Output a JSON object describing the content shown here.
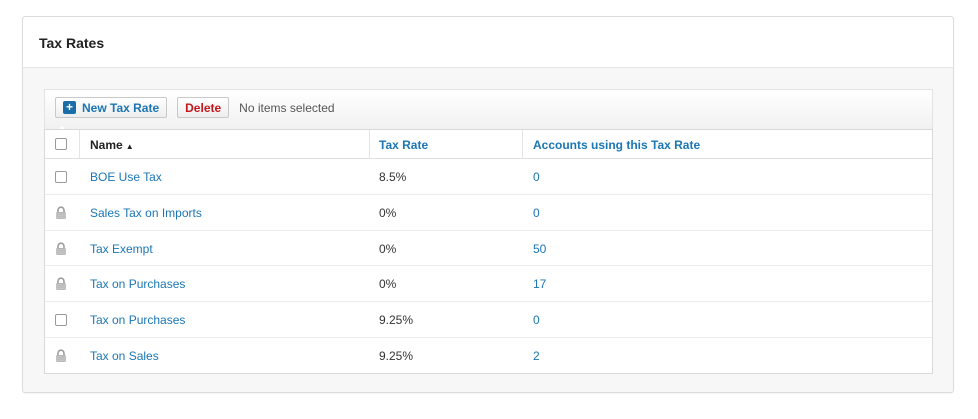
{
  "panel": {
    "title": "Tax Rates"
  },
  "toolbar": {
    "new_label": "New Tax Rate",
    "delete_label": "Delete",
    "status": "No items selected"
  },
  "table": {
    "columns": {
      "name": "Name",
      "rate": "Tax Rate",
      "accounts": "Accounts using this Tax Rate"
    },
    "sort": {
      "column": "Name",
      "direction": "ascending"
    },
    "rows": [
      {
        "name": "BOE Use Tax",
        "rate": "8.5%",
        "accounts": "0",
        "locked": false
      },
      {
        "name": "Sales Tax on Imports",
        "rate": "0%",
        "accounts": "0",
        "locked": true
      },
      {
        "name": "Tax Exempt",
        "rate": "0%",
        "accounts": "50",
        "locked": true
      },
      {
        "name": "Tax on Purchases",
        "rate": "0%",
        "accounts": "17",
        "locked": true
      },
      {
        "name": "Tax on Purchases",
        "rate": "9.25%",
        "accounts": "0",
        "locked": false
      },
      {
        "name": "Tax on Sales",
        "rate": "9.25%",
        "accounts": "2",
        "locked": true
      }
    ]
  },
  "colors": {
    "link": "#1b76b3",
    "delete": "#c3161c",
    "plus_icon_bg": "#1a6ea8"
  },
  "icons": {
    "plus": "plus-icon",
    "lock": "lock-icon",
    "sort": "sort-ascending-icon"
  }
}
